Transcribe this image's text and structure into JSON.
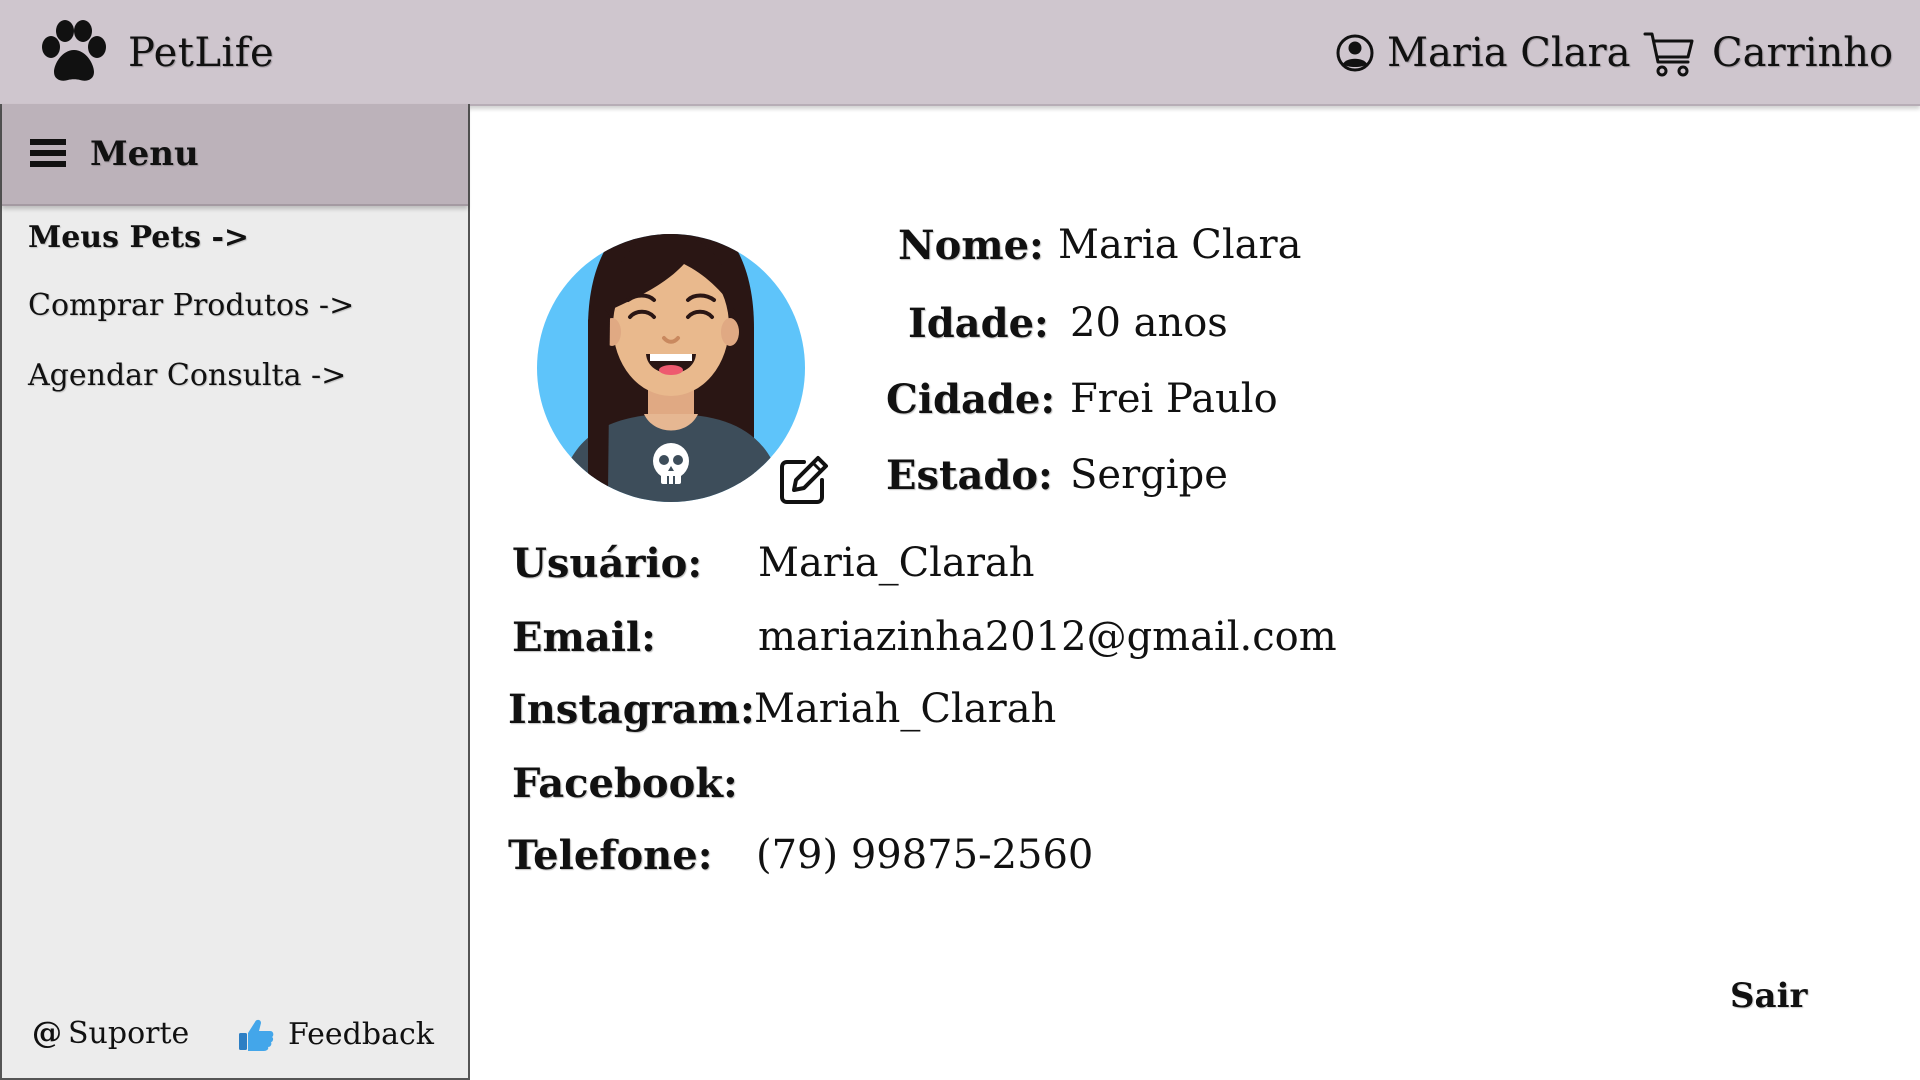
{
  "header": {
    "brand": "PetLife",
    "brand_icon": "paw-icon",
    "user_name": "Maria Clara",
    "user_icon": "user-circle-icon",
    "cart_label": "Carrinho",
    "cart_icon": "cart-icon"
  },
  "sidebar": {
    "menu_label": "Menu",
    "menu_icon": "hamburger-icon",
    "items": [
      {
        "label": "Meus Pets ->"
      },
      {
        "label": "Comprar Produtos ->"
      },
      {
        "label": "Agendar Consulta ->"
      }
    ],
    "footer": {
      "support_symbol": "@",
      "support_label": "Suporte",
      "feedback_label": "Feedback",
      "feedback_icon": "thumbs-up-icon"
    }
  },
  "profile": {
    "avatar_icon": "avatar-girl-icon",
    "edit_icon": "edit-icon",
    "nome_label": "Nome:",
    "nome_value": "Maria Clara",
    "idade_label": "Idade:",
    "idade_value": "20 anos",
    "cidade_label": "Cidade:",
    "cidade_value": "Frei Paulo",
    "estado_label": "Estado:",
    "estado_value": "Sergipe",
    "usuario_label": "Usuário:",
    "usuario_value": "Maria_Clarah",
    "email_label": "Email:",
    "email_value": "mariazinha2012@gmail.com",
    "instagram_label": "Instagram:",
    "instagram_value": "Mariah_Clarah",
    "facebook_label": "Facebook:",
    "facebook_value": "",
    "telefone_label": "Telefone:",
    "telefone_value": "(79) 99875-2560"
  },
  "actions": {
    "logout_label": "Sair"
  },
  "colors": {
    "header_bg": "#cfc6ce",
    "menu_header_bg": "#bcb2ba",
    "sidebar_bg": "#ececec",
    "avatar_bg": "#5ec4fa",
    "feedback_icon": "#3b9be0"
  }
}
